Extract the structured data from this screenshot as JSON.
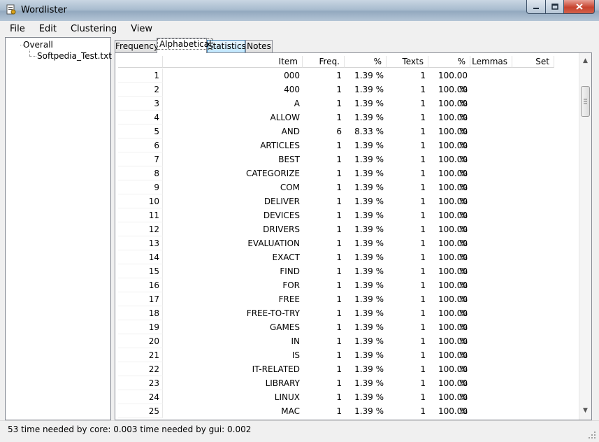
{
  "window": {
    "title": "Wordlister"
  },
  "menu": [
    "File",
    "Edit",
    "Clustering",
    "View"
  ],
  "tree": {
    "root": "Overall",
    "child": "Softpedia_Test.txt"
  },
  "tabs": [
    "Frequency",
    "Alphabetical",
    "Statistics",
    "Notes"
  ],
  "active_tab": "Alphabetical",
  "columns": [
    "Item",
    "Freq.",
    "%",
    "Texts",
    "%",
    "Lemmas",
    "Set"
  ],
  "rows": [
    {
      "n": "1",
      "item": "000",
      "freq": "1",
      "pct": "1.39 %",
      "texts": "1",
      "tpct": "100.00 %"
    },
    {
      "n": "2",
      "item": "400",
      "freq": "1",
      "pct": "1.39 %",
      "texts": "1",
      "tpct": "100.00 %"
    },
    {
      "n": "3",
      "item": "A",
      "freq": "1",
      "pct": "1.39 %",
      "texts": "1",
      "tpct": "100.00 %"
    },
    {
      "n": "4",
      "item": "ALLOW",
      "freq": "1",
      "pct": "1.39 %",
      "texts": "1",
      "tpct": "100.00 %"
    },
    {
      "n": "5",
      "item": "AND",
      "freq": "6",
      "pct": "8.33 %",
      "texts": "1",
      "tpct": "100.00 %"
    },
    {
      "n": "6",
      "item": "ARTICLES",
      "freq": "1",
      "pct": "1.39 %",
      "texts": "1",
      "tpct": "100.00 %"
    },
    {
      "n": "7",
      "item": "BEST",
      "freq": "1",
      "pct": "1.39 %",
      "texts": "1",
      "tpct": "100.00 %"
    },
    {
      "n": "8",
      "item": "CATEGORIZE",
      "freq": "1",
      "pct": "1.39 %",
      "texts": "1",
      "tpct": "100.00 %"
    },
    {
      "n": "9",
      "item": "COM",
      "freq": "1",
      "pct": "1.39 %",
      "texts": "1",
      "tpct": "100.00 %"
    },
    {
      "n": "10",
      "item": "DELIVER",
      "freq": "1",
      "pct": "1.39 %",
      "texts": "1",
      "tpct": "100.00 %"
    },
    {
      "n": "11",
      "item": "DEVICES",
      "freq": "1",
      "pct": "1.39 %",
      "texts": "1",
      "tpct": "100.00 %"
    },
    {
      "n": "12",
      "item": "DRIVERS",
      "freq": "1",
      "pct": "1.39 %",
      "texts": "1",
      "tpct": "100.00 %"
    },
    {
      "n": "13",
      "item": "EVALUATION",
      "freq": "1",
      "pct": "1.39 %",
      "texts": "1",
      "tpct": "100.00 %"
    },
    {
      "n": "14",
      "item": "EXACT",
      "freq": "1",
      "pct": "1.39 %",
      "texts": "1",
      "tpct": "100.00 %"
    },
    {
      "n": "15",
      "item": "FIND",
      "freq": "1",
      "pct": "1.39 %",
      "texts": "1",
      "tpct": "100.00 %"
    },
    {
      "n": "16",
      "item": "FOR",
      "freq": "1",
      "pct": "1.39 %",
      "texts": "1",
      "tpct": "100.00 %"
    },
    {
      "n": "17",
      "item": "FREE",
      "freq": "1",
      "pct": "1.39 %",
      "texts": "1",
      "tpct": "100.00 %"
    },
    {
      "n": "18",
      "item": "FREE-TO-TRY",
      "freq": "1",
      "pct": "1.39 %",
      "texts": "1",
      "tpct": "100.00 %"
    },
    {
      "n": "19",
      "item": "GAMES",
      "freq": "1",
      "pct": "1.39 %",
      "texts": "1",
      "tpct": "100.00 %"
    },
    {
      "n": "20",
      "item": "IN",
      "freq": "1",
      "pct": "1.39 %",
      "texts": "1",
      "tpct": "100.00 %"
    },
    {
      "n": "21",
      "item": "IS",
      "freq": "1",
      "pct": "1.39 %",
      "texts": "1",
      "tpct": "100.00 %"
    },
    {
      "n": "22",
      "item": "IT-RELATED",
      "freq": "1",
      "pct": "1.39 %",
      "texts": "1",
      "tpct": "100.00 %"
    },
    {
      "n": "23",
      "item": "LIBRARY",
      "freq": "1",
      "pct": "1.39 %",
      "texts": "1",
      "tpct": "100.00 %"
    },
    {
      "n": "24",
      "item": "LINUX",
      "freq": "1",
      "pct": "1.39 %",
      "texts": "1",
      "tpct": "100.00 %"
    },
    {
      "n": "25",
      "item": "MAC",
      "freq": "1",
      "pct": "1.39 %",
      "texts": "1",
      "tpct": "100.00 %"
    }
  ],
  "status": "53  time needed by core: 0.003  time needed by gui: 0.002"
}
